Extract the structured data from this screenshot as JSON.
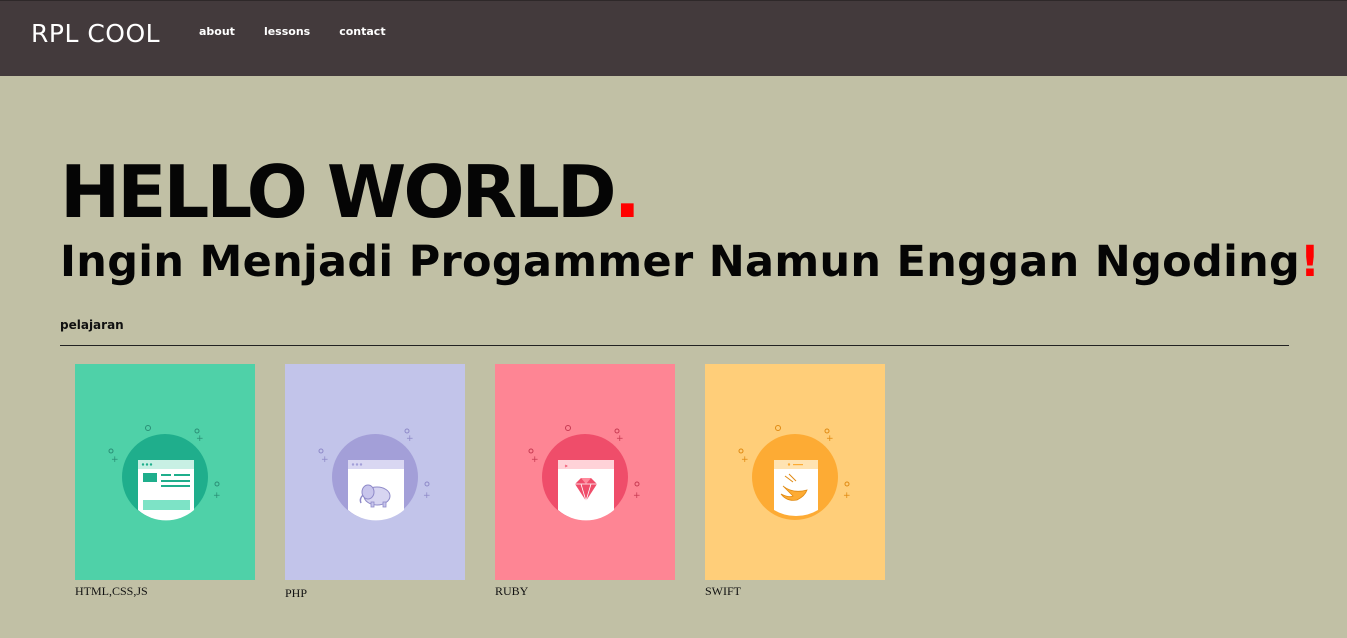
{
  "navbar": {
    "brand": "RPL COOL",
    "links": [
      "about",
      "lessons",
      "contact"
    ]
  },
  "hero": {
    "title": "HELLO WORLD",
    "title_dot": ".",
    "subtitle": "Ingin Menjadi Progammer Namun Enggan Ngoding",
    "subtitle_mark": "!"
  },
  "section": {
    "label": "pelajaran"
  },
  "courses": [
    {
      "label": "HTML,CSS,JS",
      "icon": "web-browser-icon",
      "bg": "#4fd1a8",
      "circle": "#1fae8c"
    },
    {
      "label": "PHP",
      "icon": "elephant-icon",
      "bg": "#c2c4ea",
      "circle": "#a39fd8"
    },
    {
      "label": "RUBY",
      "icon": "ruby-gem-icon",
      "bg": "#fe8594",
      "circle": "#ef4d6a"
    },
    {
      "label": "SWIFT",
      "icon": "swift-bird-icon",
      "bg": "#ffce79",
      "circle": "#fdab34"
    }
  ],
  "colors": {
    "navbar": "#433a3c",
    "page": "#c1c0a5",
    "accent": "#ff0000"
  }
}
